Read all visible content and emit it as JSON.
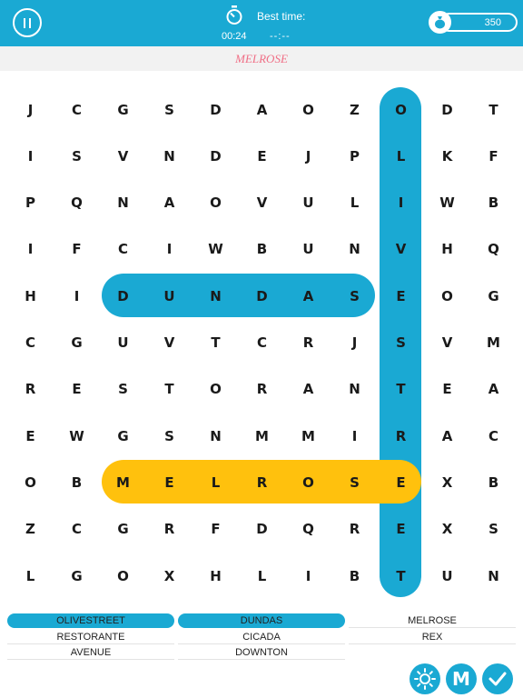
{
  "header": {
    "best_label": "Best time:",
    "time": "00:24",
    "best_time": "--:--",
    "coins": "350"
  },
  "current_word": "MELROSE",
  "colors": {
    "brand_blue": "#1aa9d3",
    "found_yellow": "#ffc10d",
    "current_word_pink": "#f06f86"
  },
  "grid": [
    [
      "J",
      "C",
      "G",
      "S",
      "D",
      "A",
      "O",
      "Z",
      "O",
      "D",
      "T"
    ],
    [
      "I",
      "S",
      "V",
      "N",
      "D",
      "E",
      "J",
      "P",
      "L",
      "K",
      "F"
    ],
    [
      "P",
      "Q",
      "N",
      "A",
      "O",
      "V",
      "U",
      "L",
      "I",
      "W",
      "B"
    ],
    [
      "I",
      "F",
      "C",
      "I",
      "W",
      "B",
      "U",
      "N",
      "V",
      "H",
      "Q"
    ],
    [
      "H",
      "I",
      "D",
      "U",
      "N",
      "D",
      "A",
      "S",
      "E",
      "O",
      "G"
    ],
    [
      "C",
      "G",
      "U",
      "V",
      "T",
      "C",
      "R",
      "J",
      "S",
      "V",
      "M"
    ],
    [
      "R",
      "E",
      "S",
      "T",
      "O",
      "R",
      "A",
      "N",
      "T",
      "E",
      "A"
    ],
    [
      "E",
      "W",
      "G",
      "S",
      "N",
      "M",
      "M",
      "I",
      "R",
      "A",
      "C"
    ],
    [
      "O",
      "B",
      "M",
      "E",
      "L",
      "R",
      "O",
      "S",
      "E",
      "X",
      "B"
    ],
    [
      "Z",
      "C",
      "G",
      "R",
      "F",
      "D",
      "Q",
      "R",
      "E",
      "X",
      "S"
    ],
    [
      "L",
      "G",
      "O",
      "X",
      "H",
      "L",
      "I",
      "B",
      "T",
      "U",
      "N"
    ]
  ],
  "found_words": [
    {
      "word": "OLIVESTREET",
      "start": [
        0,
        8
      ],
      "end": [
        10,
        8
      ],
      "color": "#1aa9d3"
    },
    {
      "word": "DUNDAS",
      "start": [
        4,
        2
      ],
      "end": [
        4,
        7
      ],
      "color": "#1aa9d3"
    },
    {
      "word": "MELROSE",
      "start": [
        8,
        2
      ],
      "end": [
        8,
        8
      ],
      "color": "#ffc10d"
    }
  ],
  "words": [
    {
      "label": "OLIVESTREET",
      "found": true
    },
    {
      "label": "DUNDAS",
      "found": true
    },
    {
      "label": "MELROSE",
      "found": false
    },
    {
      "label": "RESTORANTE",
      "found": false
    },
    {
      "label": "CICADA",
      "found": false
    },
    {
      "label": "REX",
      "found": false
    },
    {
      "label": "AVENUE",
      "found": false
    },
    {
      "label": "DOWNTON",
      "found": false
    }
  ],
  "buttons": {
    "hint_icon": "sun-icon",
    "mode_letter": "M",
    "check_icon": "check-icon"
  }
}
